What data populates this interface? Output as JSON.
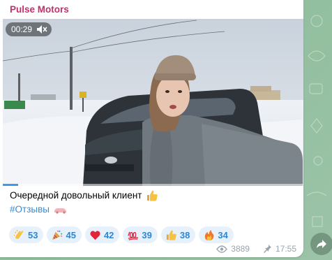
{
  "channel": {
    "name": "Pulse Motors"
  },
  "video": {
    "duration": "00:29",
    "muted": true,
    "progress": 0.05
  },
  "caption": {
    "text": "Очередной довольный клиент",
    "hashtag": "#Отзывы"
  },
  "reactions": [
    {
      "emoji": "clap-emoji",
      "count": "53"
    },
    {
      "emoji": "party-popper-emoji",
      "count": "45"
    },
    {
      "emoji": "red-heart-emoji",
      "count": "42"
    },
    {
      "emoji": "hundred-points-emoji",
      "count": "39"
    },
    {
      "emoji": "thumbs-up-emoji",
      "count": "38"
    },
    {
      "emoji": "fire-emoji",
      "count": "34"
    }
  ],
  "meta": {
    "views": "3889",
    "time": "17:55"
  },
  "colors": {
    "channel_name": "#c2306b",
    "link": "#3a8ad1",
    "reaction_bg": "#e6f1fb",
    "reaction_text": "#2f86d1"
  }
}
